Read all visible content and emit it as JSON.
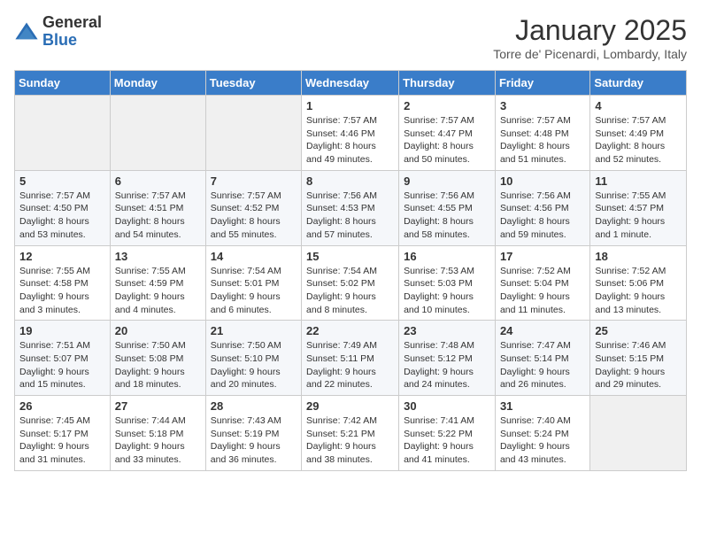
{
  "logo": {
    "general": "General",
    "blue": "Blue"
  },
  "header": {
    "month": "January 2025",
    "location": "Torre de' Picenardi, Lombardy, Italy"
  },
  "weekdays": [
    "Sunday",
    "Monday",
    "Tuesday",
    "Wednesday",
    "Thursday",
    "Friday",
    "Saturday"
  ],
  "weeks": [
    [
      {
        "day": "",
        "empty": true
      },
      {
        "day": "",
        "empty": true
      },
      {
        "day": "",
        "empty": true
      },
      {
        "day": "1",
        "sunrise": "7:57 AM",
        "sunset": "4:46 PM",
        "daylight": "8 hours and 49 minutes."
      },
      {
        "day": "2",
        "sunrise": "7:57 AM",
        "sunset": "4:47 PM",
        "daylight": "8 hours and 50 minutes."
      },
      {
        "day": "3",
        "sunrise": "7:57 AM",
        "sunset": "4:48 PM",
        "daylight": "8 hours and 51 minutes."
      },
      {
        "day": "4",
        "sunrise": "7:57 AM",
        "sunset": "4:49 PM",
        "daylight": "8 hours and 52 minutes."
      }
    ],
    [
      {
        "day": "5",
        "sunrise": "7:57 AM",
        "sunset": "4:50 PM",
        "daylight": "8 hours and 53 minutes."
      },
      {
        "day": "6",
        "sunrise": "7:57 AM",
        "sunset": "4:51 PM",
        "daylight": "8 hours and 54 minutes."
      },
      {
        "day": "7",
        "sunrise": "7:57 AM",
        "sunset": "4:52 PM",
        "daylight": "8 hours and 55 minutes."
      },
      {
        "day": "8",
        "sunrise": "7:56 AM",
        "sunset": "4:53 PM",
        "daylight": "8 hours and 57 minutes."
      },
      {
        "day": "9",
        "sunrise": "7:56 AM",
        "sunset": "4:55 PM",
        "daylight": "8 hours and 58 minutes."
      },
      {
        "day": "10",
        "sunrise": "7:56 AM",
        "sunset": "4:56 PM",
        "daylight": "8 hours and 59 minutes."
      },
      {
        "day": "11",
        "sunrise": "7:55 AM",
        "sunset": "4:57 PM",
        "daylight": "9 hours and 1 minute."
      }
    ],
    [
      {
        "day": "12",
        "sunrise": "7:55 AM",
        "sunset": "4:58 PM",
        "daylight": "9 hours and 3 minutes."
      },
      {
        "day": "13",
        "sunrise": "7:55 AM",
        "sunset": "4:59 PM",
        "daylight": "9 hours and 4 minutes."
      },
      {
        "day": "14",
        "sunrise": "7:54 AM",
        "sunset": "5:01 PM",
        "daylight": "9 hours and 6 minutes."
      },
      {
        "day": "15",
        "sunrise": "7:54 AM",
        "sunset": "5:02 PM",
        "daylight": "9 hours and 8 minutes."
      },
      {
        "day": "16",
        "sunrise": "7:53 AM",
        "sunset": "5:03 PM",
        "daylight": "9 hours and 10 minutes."
      },
      {
        "day": "17",
        "sunrise": "7:52 AM",
        "sunset": "5:04 PM",
        "daylight": "9 hours and 11 minutes."
      },
      {
        "day": "18",
        "sunrise": "7:52 AM",
        "sunset": "5:06 PM",
        "daylight": "9 hours and 13 minutes."
      }
    ],
    [
      {
        "day": "19",
        "sunrise": "7:51 AM",
        "sunset": "5:07 PM",
        "daylight": "9 hours and 15 minutes."
      },
      {
        "day": "20",
        "sunrise": "7:50 AM",
        "sunset": "5:08 PM",
        "daylight": "9 hours and 18 minutes."
      },
      {
        "day": "21",
        "sunrise": "7:50 AM",
        "sunset": "5:10 PM",
        "daylight": "9 hours and 20 minutes."
      },
      {
        "day": "22",
        "sunrise": "7:49 AM",
        "sunset": "5:11 PM",
        "daylight": "9 hours and 22 minutes."
      },
      {
        "day": "23",
        "sunrise": "7:48 AM",
        "sunset": "5:12 PM",
        "daylight": "9 hours and 24 minutes."
      },
      {
        "day": "24",
        "sunrise": "7:47 AM",
        "sunset": "5:14 PM",
        "daylight": "9 hours and 26 minutes."
      },
      {
        "day": "25",
        "sunrise": "7:46 AM",
        "sunset": "5:15 PM",
        "daylight": "9 hours and 29 minutes."
      }
    ],
    [
      {
        "day": "26",
        "sunrise": "7:45 AM",
        "sunset": "5:17 PM",
        "daylight": "9 hours and 31 minutes."
      },
      {
        "day": "27",
        "sunrise": "7:44 AM",
        "sunset": "5:18 PM",
        "daylight": "9 hours and 33 minutes."
      },
      {
        "day": "28",
        "sunrise": "7:43 AM",
        "sunset": "5:19 PM",
        "daylight": "9 hours and 36 minutes."
      },
      {
        "day": "29",
        "sunrise": "7:42 AM",
        "sunset": "5:21 PM",
        "daylight": "9 hours and 38 minutes."
      },
      {
        "day": "30",
        "sunrise": "7:41 AM",
        "sunset": "5:22 PM",
        "daylight": "9 hours and 41 minutes."
      },
      {
        "day": "31",
        "sunrise": "7:40 AM",
        "sunset": "5:24 PM",
        "daylight": "9 hours and 43 minutes."
      },
      {
        "day": "",
        "empty": true
      }
    ]
  ],
  "labels": {
    "sunrise": "Sunrise:",
    "sunset": "Sunset:",
    "daylight": "Daylight:"
  }
}
